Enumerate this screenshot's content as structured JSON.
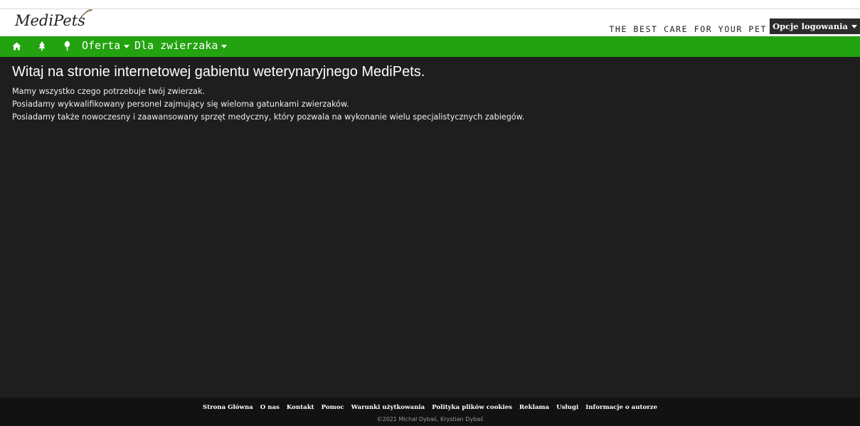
{
  "header": {
    "logo_text": "MediPets",
    "tagline": "THE BEST CARE FOR YOUR PET",
    "login_label": "Opcje logowania"
  },
  "nav": {
    "icons": [
      "home-icon",
      "tree-icon",
      "plant-icon"
    ],
    "items": [
      {
        "label": "Oferta"
      },
      {
        "label": "Dla zwierzaka"
      }
    ]
  },
  "main": {
    "title": "Witaj na stronie internetowej gabientu weterynaryjnego MediPets.",
    "paragraphs": [
      "Mamy wszystko czego potrzebuje twój zwierzak.",
      "Posiadamy wykwalifikowany personel zajmujący się wieloma gatunkami zwierzaków.",
      "Posiadamy także nowoczesny i zaawansowany sprzęt medyczny, który pozwala na wykonanie wielu specjalistycznych zabiegów."
    ]
  },
  "footer": {
    "links": [
      "Strona Główna",
      "O nas",
      "Kontakt",
      "Pomoc",
      "Warunki użytkowania",
      "Polityka plików cookies",
      "Reklama",
      "Usługi",
      "Informacje o autorze"
    ],
    "copyright": "©2021 Michał Dybaś, Krystian Dybaś"
  },
  "colors": {
    "nav_green": "#22a30f",
    "main_bg": "#1e1e1e",
    "footer_bg": "#121212",
    "login_bg": "#2b2b2b"
  }
}
